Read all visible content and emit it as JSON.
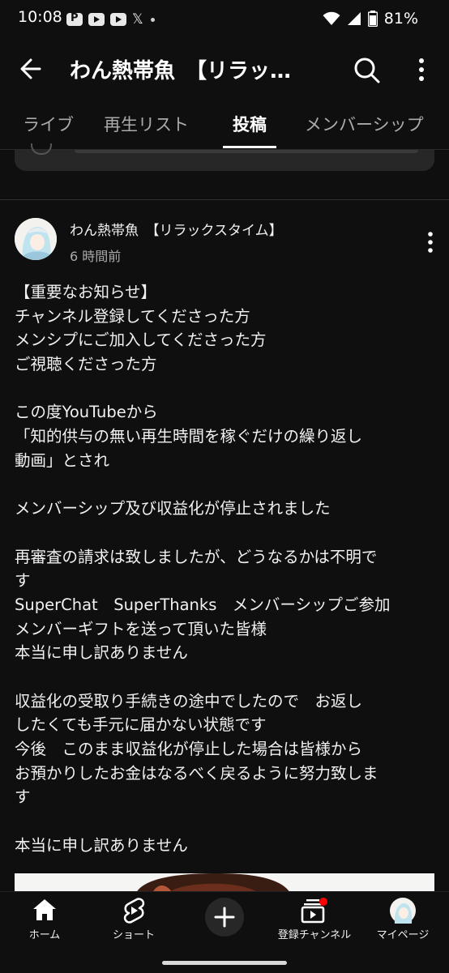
{
  "status_bar": {
    "time": "10:08",
    "battery": "81%",
    "icons": [
      "pinterest-icon",
      "youtube-icon",
      "youtube-icon",
      "x-icon",
      "dot-icon",
      "wifi-icon",
      "signal-icon",
      "battery-icon"
    ]
  },
  "header": {
    "title": "わん熱帯魚　【リラッ…"
  },
  "tabs": [
    {
      "label": "ライブ"
    },
    {
      "label": "再生リスト"
    },
    {
      "label": "投稿",
      "active": true
    },
    {
      "label": "メンバーシップ"
    }
  ],
  "post": {
    "author": "わん熱帯魚　【リラックスタイム】",
    "timestamp": "6 時間前",
    "lines": [
      "【重要なお知らせ】",
      "チャンネル登録してくださった方",
      "メンシプにご加入してくださった方",
      "ご視聴くださった方",
      "",
      "この度YouTubeから",
      "「知的供与の無い再生時間を稼ぐだけの繰り返し",
      "動画」とされ",
      "",
      "メンバーシップ及び収益化が停止されました",
      "",
      "再審査の請求は致しましたが、どうなるかは不明で",
      "す",
      "SuperChat　SuperThanks　メンバーシップご参加",
      "メンバーギフトを送って頂いた皆様",
      "本当に申し訳ありません",
      "",
      "収益化の受取り手続きの途中でしたので　お返し",
      "したくても手元に届かない状態です",
      "今後　このまま収益化が停止した場合は皆様から",
      "お預かりしたお金はなるべく戻るように努力致しま",
      "す",
      "",
      "本当に申し訳ありません"
    ]
  },
  "bottom_nav": [
    {
      "label": "ホーム",
      "icon": "home-icon"
    },
    {
      "label": "ショート",
      "icon": "shorts-icon"
    },
    {
      "label": "",
      "icon": "plus-icon"
    },
    {
      "label": "登録チャンネル",
      "icon": "subscriptions-icon"
    },
    {
      "label": "マイページ",
      "icon": "avatar-icon"
    }
  ],
  "colors": {
    "background": "#0f0f0f",
    "text": "#f1f1f1",
    "secondary_text": "#aaaaaa",
    "notification_dot": "#ff0000"
  }
}
